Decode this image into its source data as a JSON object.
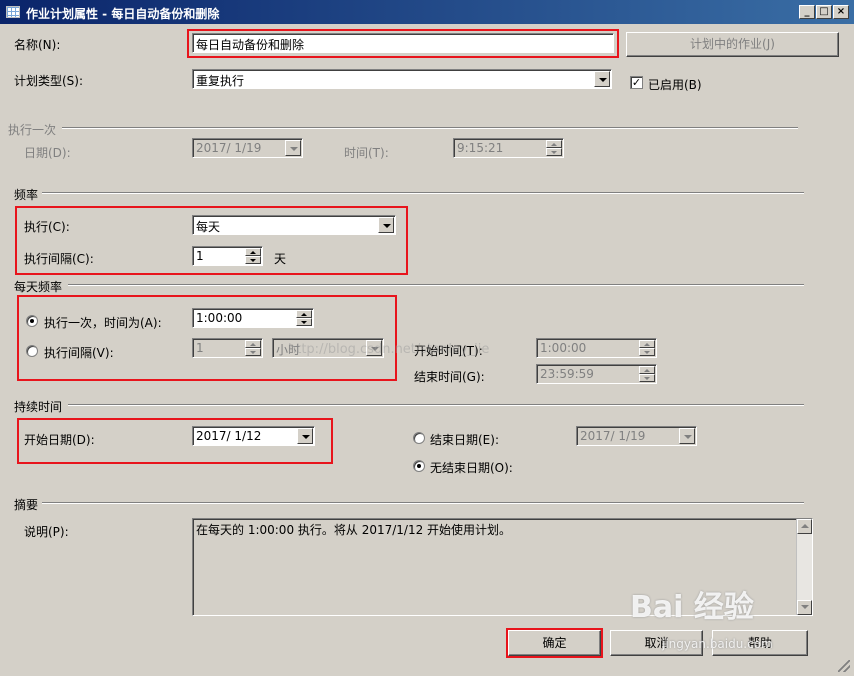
{
  "window": {
    "title": "作业计划属性 - 每日自动备份和删除",
    "minimize": "_",
    "maximize": "□",
    "close": "×"
  },
  "name_row": {
    "label": "名称(N):",
    "value": "每日自动备份和删除",
    "jobs_button": "计划中的作业(J)"
  },
  "schedule_type": {
    "label": "计划类型(S):",
    "value": "重复执行",
    "enabled_label": "已启用(B)",
    "enabled_checked": true,
    "check_mark": "✓"
  },
  "one_time": {
    "section": "执行一次",
    "date_label": "日期(D):",
    "date_value": "2017/ 1/19",
    "time_label": "时间(T):",
    "time_value": "9:15:21"
  },
  "frequency": {
    "section": "频率",
    "occurs_label": "执行(C):",
    "occurs_value": "每天",
    "recurs_label": "执行间隔(C):",
    "recurs_value": "1",
    "recurs_unit": "天"
  },
  "daily_frequency": {
    "section": "每天频率",
    "once_label": "执行一次，时间为(A):",
    "once_value": "1:00:00",
    "once_selected": true,
    "every_label": "执行间隔(V):",
    "every_value": "1",
    "every_unit": "小时",
    "start_label": "开始时间(T):",
    "start_value": "1:00:00",
    "end_label": "结束时间(G):",
    "end_value": "23:59:59"
  },
  "duration": {
    "section": "持续时间",
    "start_label": "开始日期(D):",
    "start_value": "2017/ 1/12",
    "end_date_label": "结束日期(E):",
    "end_date_value": "2017/ 1/19",
    "no_end_label": "无结束日期(O):",
    "no_end_selected": true
  },
  "summary": {
    "section": "摘要",
    "desc_label": "说明(P):",
    "desc_text": "在每天的 1:00:00 执行。将从 2017/1/12 开始使用计划。"
  },
  "buttons": {
    "ok": "确定",
    "cancel": "取消",
    "help": "帮助"
  },
  "watermark": {
    "url": "http://blog.csdn.net/stanley_jie",
    "brand": "Bai 经验",
    "site": "jingyan.baidu.com"
  },
  "colors": {
    "highlight": "#e8141c",
    "title_bar": "#0a246a"
  }
}
